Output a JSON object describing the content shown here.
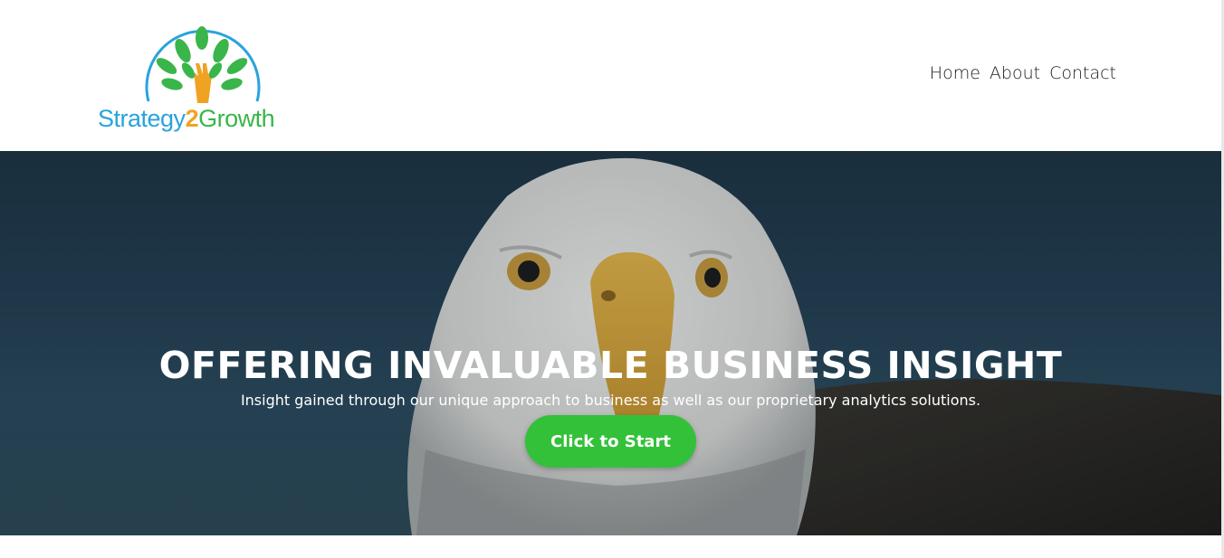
{
  "brand": {
    "name_part1": "Strategy",
    "name_part2": "2",
    "name_part3": "Growth",
    "logo_icon": "tree-hand-icon",
    "colors": {
      "blue": "#29a3dc",
      "orange": "#f0a323",
      "green": "#3ab54a"
    }
  },
  "nav": {
    "items": [
      {
        "label": "Home"
      },
      {
        "label": "About"
      },
      {
        "label": "Contact"
      }
    ]
  },
  "hero": {
    "title": "OFFERING INVALUABLE BUSINESS INSIGHT",
    "subtitle": "Insight gained through our unique approach to business as well as our proprietary analytics solutions.",
    "cta_label": "Click to Start",
    "cta_color": "#33c13a",
    "background_image": "bald-eagle-photo"
  }
}
